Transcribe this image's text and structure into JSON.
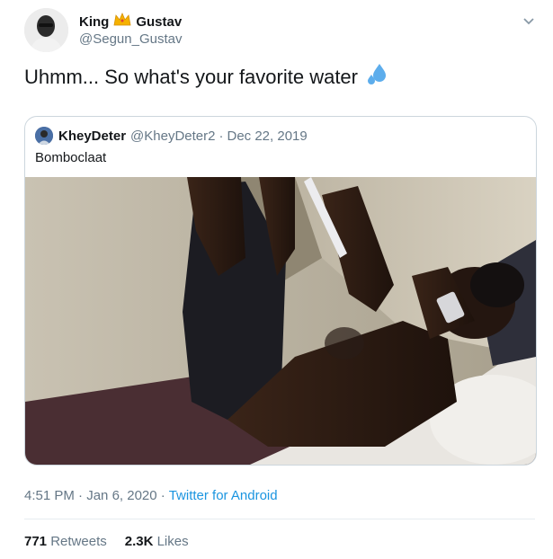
{
  "author": {
    "display_name": "King",
    "display_name_suffix": "Gustav",
    "handle": "@Segun_Gustav",
    "crown_icon": "crown-icon"
  },
  "tweet": {
    "text": "Uhmm... So what's your favorite water",
    "emoji": "sweat-droplets-icon"
  },
  "quoted_tweet": {
    "display_name": "KheyDeter",
    "handle": "@KheyDeter2",
    "separator": "·",
    "date": "Dec 22, 2019",
    "text": "Bomboclaat"
  },
  "meta": {
    "time": "4:51 PM",
    "separator1": "·",
    "date": "Jan 6, 2020",
    "separator2": "·",
    "source": "Twitter for Android"
  },
  "stats": {
    "retweets_count": "771",
    "retweets_label": "Retweets",
    "likes_count": "2.3K",
    "likes_label": "Likes"
  },
  "colors": {
    "link": "#1b95e0",
    "muted": "#657786",
    "border": "#ccd6dd"
  }
}
